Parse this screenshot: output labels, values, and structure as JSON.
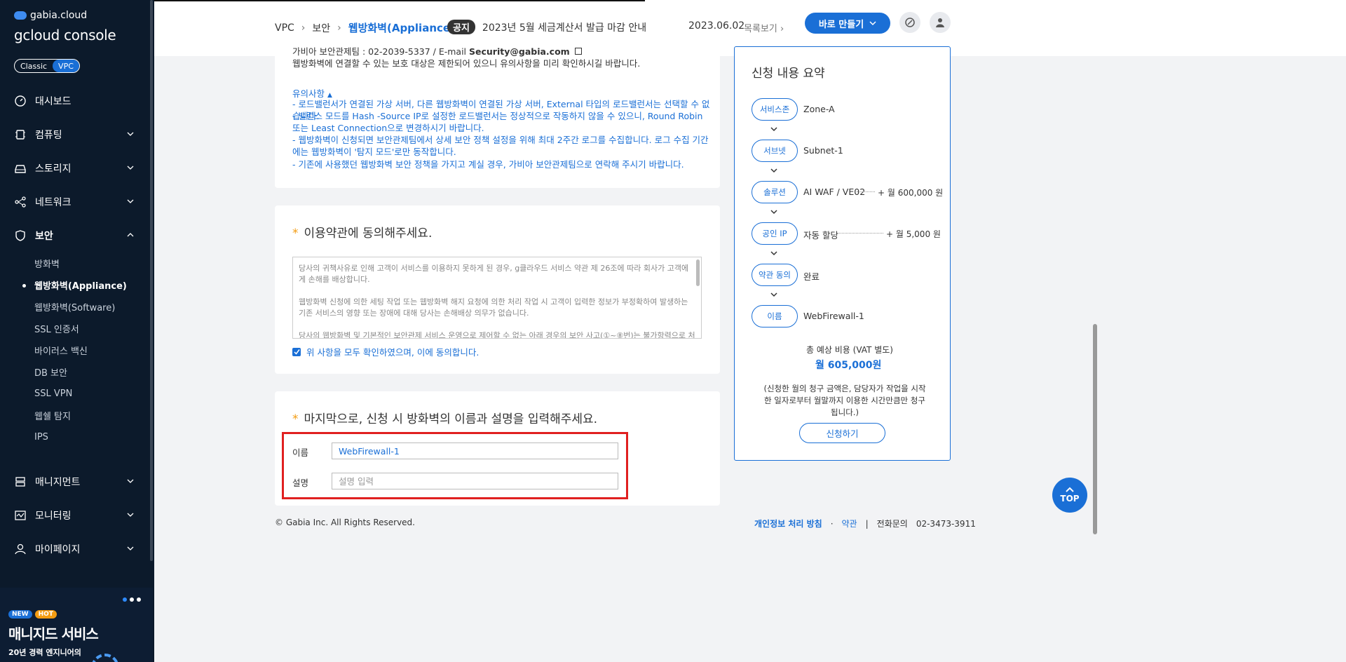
{
  "sidebar": {
    "brand_small": "gabia.cloud",
    "brand_big": "gcloud console",
    "toggle": {
      "classic": "Classic",
      "vpc": "VPC"
    },
    "items": [
      {
        "label": "대시보드"
      },
      {
        "label": "컴퓨팅"
      },
      {
        "label": "스토리지"
      },
      {
        "label": "네트워크"
      },
      {
        "label": "보안"
      }
    ],
    "security_sub": [
      "방화벽",
      "웹방화벽(Appliance)",
      "웹방화벽(Software)",
      "SSL 인증서",
      "바이러스 백신",
      "DB 보안",
      "SSL VPN",
      "웹쉘 탐지",
      "IPS"
    ],
    "bottom_items": [
      {
        "label": "매니지먼트"
      },
      {
        "label": "모니터링"
      },
      {
        "label": "마이페이지"
      }
    ],
    "promo": {
      "badge_new": "NEW",
      "badge_hot": "HOT",
      "title": "매니지드 서비스",
      "subtitle": "20년 경력 엔지니어의"
    }
  },
  "header": {
    "breadcrumb": [
      "VPC",
      "보안",
      "웹방화벽(Appliance)"
    ],
    "notice_tag": "공지",
    "notice_text": "2023년 5월 세금계산서 발급 마감 안내",
    "date": "2023.06.02",
    "list_link": "목록보기",
    "make_button": "바로 만들기"
  },
  "info": {
    "contact_prefix": "가비아 보안관제팀 : 02-2039-5337 / E-mail ",
    "contact_email": "Security@gabia.com",
    "protect_note": "웹방화벽에 연결할 수 있는 보호 대상은 제한되어 있으니 유의사항을 미리 확인하시길 바랍니다.",
    "caution_title": "유의사항",
    "cautions": [
      "- 로드밸런서가 연결된 가상 서버, 다른 웹방화벽이 연결된 가상 서버, External 타입의 로드밸런서는 선택할 수 없습니다.",
      "- 밸런스 모드를 Hash -Source IP로 설정한 로드밸런서는 정상적으로 작동하지 않을 수 있으니, Round Robin 또는 Least Connection으로 변경하시기 바랍니다.",
      "- 웹방화벽이 신청되면 보안관제팀에서 상세 보안 정책 설정을 위해 최대 2주간 로그를 수집합니다. 로그 수집 기간에는 웹방화벽이 '탐지 모드'로만 동작합니다.",
      "- 기존에 사용했던 웹방화벽 보안 정책을 가지고 계실 경우, 가비아 보안관제팀으로 연락해 주시기 바랍니다."
    ]
  },
  "terms": {
    "title": "이용약관에 동의해주세요.",
    "paragraphs": [
      "당사의 귀책사유로 인해 고객이 서비스를 이용하지 못하게 된 경우, g클라우드 서비스 약관 제 26조에 따라 회사가 고객에게 손해를 배상합니다.",
      "웹방화벽 신청에 의한 세팅 작업 또는 웹방화벽 해지 요청에 의한 처리 작업 시 고객이 입력한 정보가 부정확하여 발생하는 기존 서비스의 영향 또는 장애에 대해 당사는 손해배상 의무가 없습니다.",
      "당사의 웹방화벽 및 기본적인 보안관제 서비스 운영으로 제어할 수 없는 아래 경우의 보안 사고(①~⑧번)는 불가항력으로 처리하며,"
    ],
    "agree_label": "위 사항을 모두 확인하였으며, 이에 동의합니다."
  },
  "final": {
    "title": "마지막으로, 신청 시 방화벽의 이름과 설명을 입력해주세요.",
    "name_label": "이름",
    "name_value": "WebFirewall-1",
    "desc_label": "설명",
    "desc_placeholder": "설명 입력"
  },
  "footer": {
    "copyright": "© Gabia Inc. All Rights Reserved.",
    "privacy": "개인정보 처리 방침",
    "terms": "약관",
    "contact": "전화문의",
    "phone": "02-3473-3911"
  },
  "summary": {
    "title": "신청 내용 요약",
    "steps": [
      {
        "label": "서비스존",
        "value": "Zone-A",
        "price": ""
      },
      {
        "label": "서브넷",
        "value": "Subnet-1",
        "price": ""
      },
      {
        "label": "솔루션",
        "value": "AI WAF / VE02",
        "price": "+ 월 600,000 원"
      },
      {
        "label": "공인 IP",
        "value": "자동 할당",
        "price": "+ 월 5,000 원"
      },
      {
        "label": "약관 동의",
        "value": "완료",
        "price": ""
      },
      {
        "label": "이름",
        "value": "WebFirewall-1",
        "price": ""
      }
    ],
    "total_label": "총 예상 비용 (VAT 별도)",
    "total_value": "월 605,000원",
    "note": "(신청한 월의 청구 금액은, 담당자가 작업을 시작한 일자로부터 월말까지 이용한 시간만큼만 청구됩니다.)",
    "apply_button": "신청하기"
  },
  "top_button": "TOP",
  "colors": {
    "accent": "#1a6fd6",
    "sidebar_bg": "#0c1a2b",
    "highlight": "#e02020",
    "star": "#f39c12"
  }
}
